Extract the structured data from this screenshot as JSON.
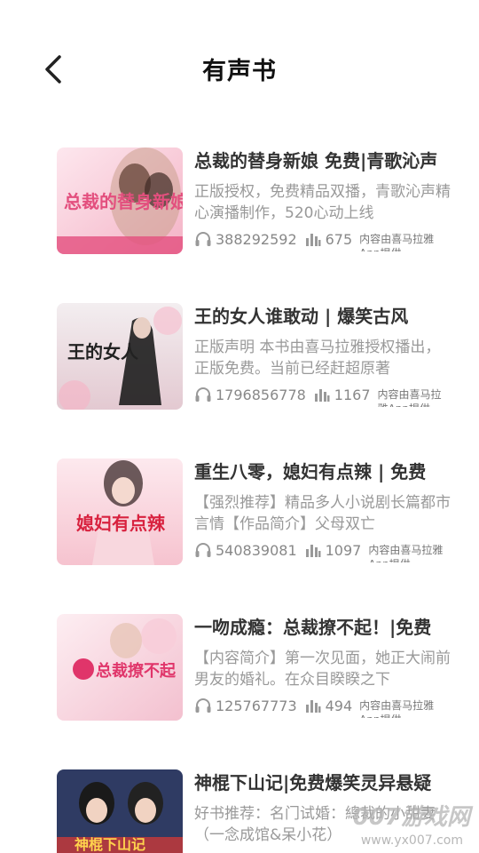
{
  "header": {
    "title": "有声书"
  },
  "books": [
    {
      "title": "总裁的替身新娘 免费|青歌沁声",
      "desc": "正版授权，免费精品双播，青歌沁声精心演播制作，520心动上线",
      "plays": "388292592",
      "episodes": "675",
      "source": "内容由喜马拉雅App提供",
      "cover_text": "总裁的替身新娘",
      "cover_colors": [
        "#f7c9d6",
        "#e34f7e"
      ]
    },
    {
      "title": "王的女人谁敢动 | 爆笑古风",
      "desc": "正版声明  本书由喜马拉雅授权播出，正版免费。当前已经赶超原著",
      "plays": "1796856778",
      "episodes": "1167",
      "source": "内容由喜马拉雅App提供",
      "cover_text": "王的女人",
      "cover_colors": [
        "#e9e4e6",
        "#2a2a2a"
      ]
    },
    {
      "title": "重生八零，媳妇有点辣 | 免费",
      "desc": "【强烈推荐】精品多人小说剧长篇都市言情【作品简介】父母双亡",
      "plays": "540839081",
      "episodes": "1097",
      "source": "内容由喜马拉雅App提供",
      "cover_text": "媳妇有点辣",
      "cover_colors": [
        "#fbe0e6",
        "#d8223f"
      ]
    },
    {
      "title": "一吻成瘾：总裁撩不起！|免费",
      "desc": "【内容简介】第一次见面，她正大闹前男友的婚礼。在众目睽睽之下",
      "plays": "125767773",
      "episodes": "494",
      "source": "内容由喜马拉雅App提供",
      "cover_text": "总裁撩不起",
      "cover_colors": [
        "#fde3ea",
        "#e0356a"
      ]
    },
    {
      "title": "神棍下山记|免费爆笑灵异悬疑",
      "desc": "好书推荐：名门试婚：總裁的小甜妻（一念成馆&呆小花）",
      "plays": "",
      "episodes": "",
      "source": "",
      "cover_text": "神棍下山记",
      "cover_colors": [
        "#3a4a78",
        "#c23a3a"
      ]
    }
  ],
  "watermark": {
    "text": "007游戏网",
    "url": "www.yx007.com"
  }
}
